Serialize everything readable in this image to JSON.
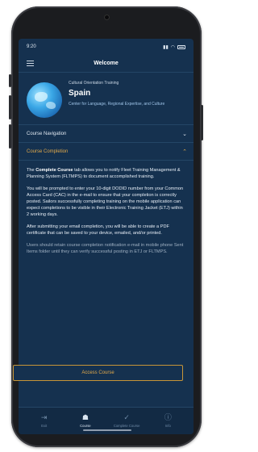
{
  "status": {
    "time": "9:20"
  },
  "navbar": {
    "title": "Welcome"
  },
  "hero": {
    "subtitle": "Cultural Orientation Training",
    "title": "Spain",
    "caption": "Center for Language, Regional Expertise, and Culture"
  },
  "sections": {
    "nav_label": "Course Navigation",
    "completion_label": "Course Completion"
  },
  "content": {
    "p1_pre": "The ",
    "p1_bold": "Complete Course",
    "p1_post": " tab allows you to notify Fleet Training Management & Planning System (FLTMPS) to document accomplished training.",
    "p2": "You will be prompted to enter your 10-digit DODID number from your Common Access Card (CAC) in the e-mail to ensure that your completion is correctly posted. Sailors successfully completing training on the mobile application can expect completions to be visible in their Electronic Training Jacket (ETJ) within 2 working days.",
    "p3": "After submitting your email completion, you will be able to create a PDF certificate that can be saved to your device, emailed, and/or printed.",
    "p4": "Users should retain course completion notification e-mail in mobile phone Sent Items folder until they can verify successful posting in ETJ or FLTMPS."
  },
  "access_button": "Access Course",
  "tabs": [
    {
      "icon": "exit-icon",
      "label": "Exit"
    },
    {
      "icon": "course-icon",
      "label": "Course"
    },
    {
      "icon": "complete-course-icon",
      "label": "Complete Course"
    },
    {
      "icon": "info-icon",
      "label": "Info"
    }
  ]
}
